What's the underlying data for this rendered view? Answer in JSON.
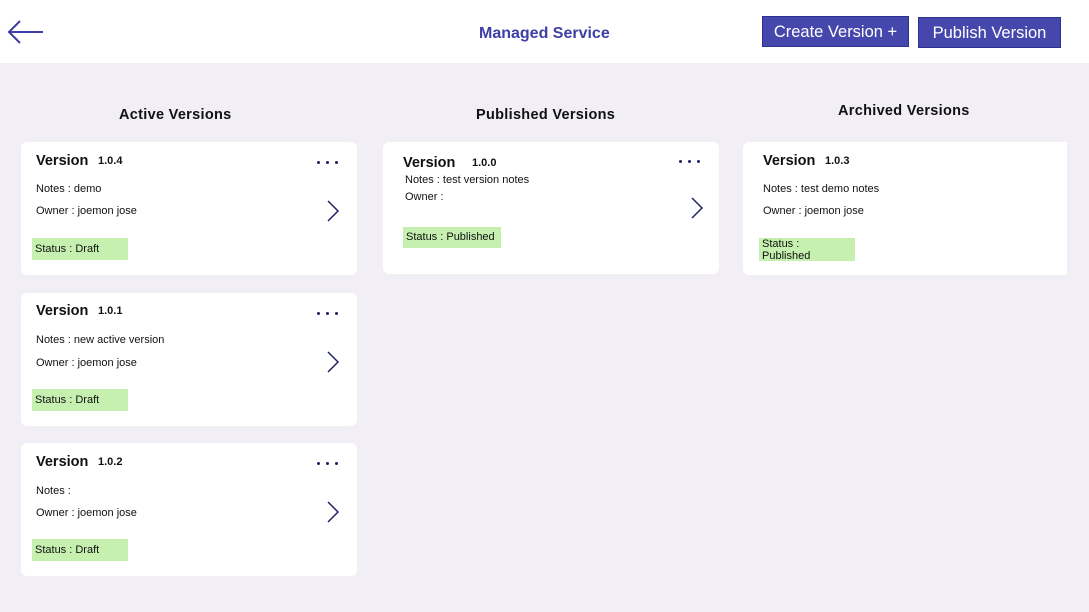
{
  "header": {
    "back_icon": "arrow-left-icon",
    "title": "Managed Service",
    "create_button": "Create Version +",
    "publish_button": "Publish Version"
  },
  "columns": {
    "active": "Active  Versions",
    "published": "Published  Versions",
    "archived": "Archived  Versions"
  },
  "cards": {
    "a1": {
      "label": "Version",
      "version": "1.0.4",
      "notes": "Notes : demo",
      "owner": "Owner : joemon jose",
      "status": "Status : Draft"
    },
    "a2": {
      "label": "Version",
      "version": "1.0.1",
      "notes": "Notes : new active version",
      "owner": "Owner : joemon jose",
      "status": "Status : Draft"
    },
    "a3": {
      "label": "Version",
      "version": "1.0.2",
      "notes": "Notes :",
      "owner": "Owner : joemon jose",
      "status": "Status : Draft"
    },
    "p1": {
      "label": "Version",
      "version": "1.0.0",
      "notes": "Notes : test version notes",
      "owner": "Owner :",
      "status": "Status : Published"
    },
    "r1": {
      "label": "Version",
      "version": "1.0.3",
      "notes": "Notes : test demo notes",
      "owner": "Owner : joemon jose",
      "status_line1": "Status :",
      "status_line2": "Published"
    }
  },
  "colors": {
    "accent": "#4547ad",
    "title": "#3d3fa6",
    "status_bg": "#c6f0b0",
    "background": "#f1eef5"
  }
}
